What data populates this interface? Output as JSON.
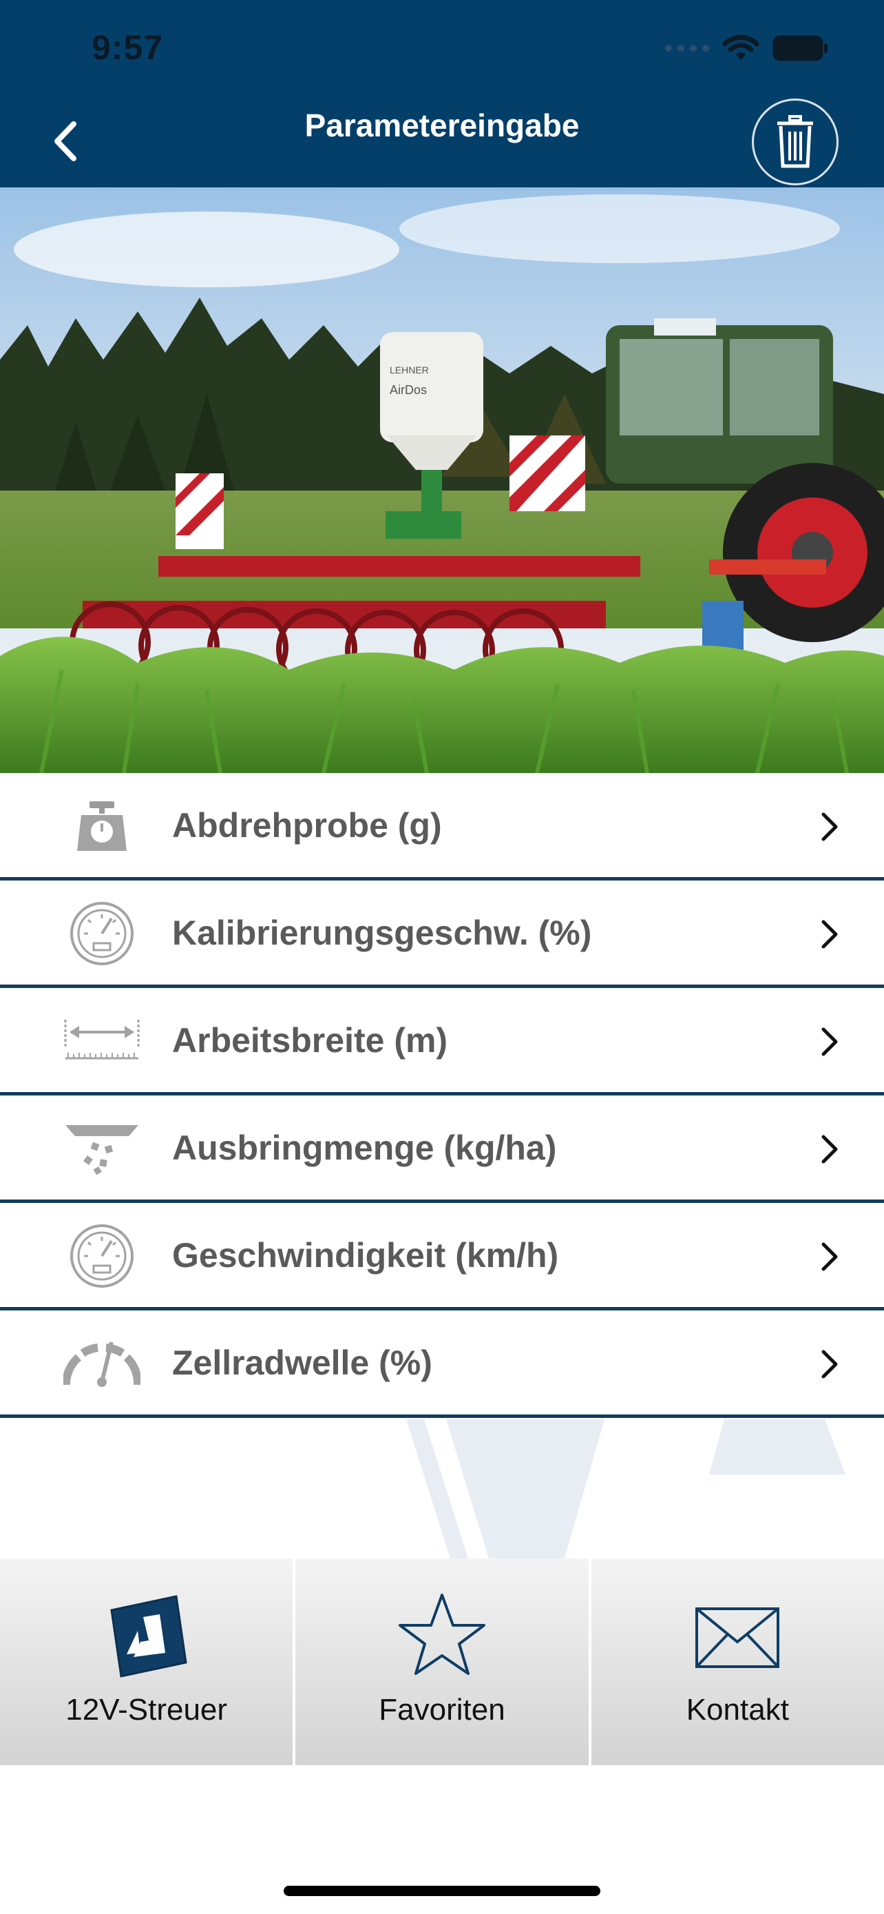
{
  "status": {
    "time": "9:57"
  },
  "header": {
    "title": "Parametereingabe"
  },
  "params": [
    {
      "label": "Abdrehprobe (g)",
      "icon": "scale-icon"
    },
    {
      "label": "Kalibrierungsgeschw. (%)",
      "icon": "gauge-icon"
    },
    {
      "label": "Arbeitsbreite (m)",
      "icon": "width-ruler-icon"
    },
    {
      "label": "Ausbringmenge (kg/ha)",
      "icon": "spread-icon"
    },
    {
      "label": "Geschwindigkeit (km/h)",
      "icon": "speedometer-icon"
    },
    {
      "label": "Zellradwelle (%)",
      "icon": "dial-icon"
    }
  ],
  "tabs": [
    {
      "label": "12V-Streuer",
      "icon": "spreader-logo-icon"
    },
    {
      "label": "Favoriten",
      "icon": "star-icon"
    },
    {
      "label": "Kontakt",
      "icon": "envelope-icon"
    }
  ],
  "colors": {
    "header": "#043f6a",
    "divider": "#0f3d5e",
    "text": "#5a5a5a"
  }
}
